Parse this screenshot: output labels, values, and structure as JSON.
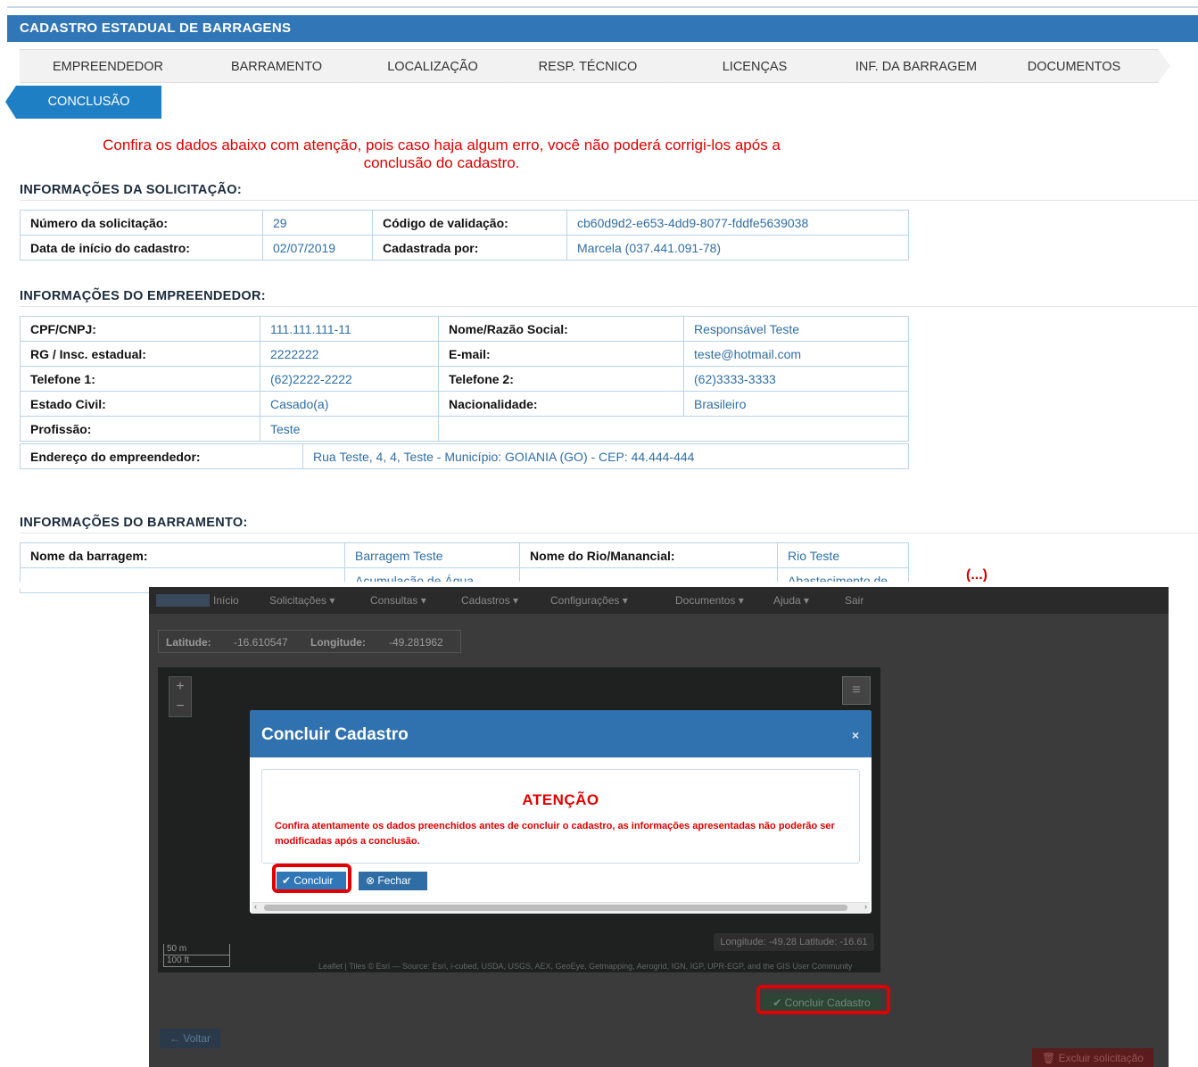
{
  "header": {
    "title": "CADASTRO ESTADUAL DE BARRAGENS"
  },
  "wizard": {
    "steps": [
      "EMPREENDEDOR",
      "BARRAMENTO",
      "LOCALIZAÇÃO",
      "RESP. TÉCNICO",
      "LICENÇAS",
      "INF. DA BARRAGEM",
      "DOCUMENTOS"
    ],
    "active_step": "CONCLUSÃO"
  },
  "warning_top": {
    "line1": "Confira os dados abaixo com atenção, pois caso haja algum erro, você não poderá corrigi-los após a",
    "line2": "conclusão do cadastro."
  },
  "solicitacao": {
    "title": "INFORMAÇÕES DA SOLICITAÇÃO:",
    "rows": [
      [
        "Número da solicitação:",
        "29",
        "Código de validação:",
        "cb60d9d2-e653-4dd9-8077-fddfe5639038"
      ],
      [
        "Data de início do cadastro:",
        "02/07/2019",
        "Cadastrada por:",
        "Marcela (037.441.091-78)"
      ]
    ]
  },
  "empreendedor": {
    "title": "INFORMAÇÕES DO EMPREENDEDOR:",
    "rows": [
      [
        "CPF/CNPJ:",
        "111.111.111-11",
        "Nome/Razão Social:",
        "Responsável Teste"
      ],
      [
        "RG / Insc. estadual:",
        "2222222",
        "E-mail:",
        "teste@hotmail.com"
      ],
      [
        "Telefone 1:",
        "(62)2222-2222",
        "Telefone 2:",
        "(62)3333-3333"
      ],
      [
        "Estado Civil:",
        "Casado(a)",
        "Nacionalidade:",
        "Brasileiro"
      ],
      [
        "Profissão:",
        "Teste",
        "",
        ""
      ]
    ],
    "endereco_label": "Endereço do empreendedor:",
    "endereco_value": "Rua Teste, 4, 4, Teste - Município: GOIANIA (GO) - CEP: 44.444-444"
  },
  "barramento": {
    "title": "INFORMAÇÕES DO BARRAMENTO:",
    "row1": [
      "Nome da barragem:",
      "Barragem Teste",
      "Nome do Rio/Manancial:",
      "Rio Teste"
    ],
    "row2_partial": [
      "Acumulação de Água -",
      "Abastecimento de"
    ]
  },
  "ellipsis": "(...)",
  "background_app": {
    "nav": [
      "Início",
      "Solicitações ▾",
      "Consultas ▾",
      "Cadastros ▾",
      "Configurações ▾",
      "Documentos ▾",
      "Ajuda ▾",
      "Sair"
    ],
    "latitude_label": "Latitude:",
    "latitude_value": "-16.610547",
    "longitude_label": "Longitude:",
    "longitude_value": "-49.281962",
    "scale_m": "50 m",
    "scale_ft": "100 ft",
    "coords_readout": "Longitude: -49.28 Latitude: -16.61",
    "attribution": "Leaflet | Tiles © Esri — Source: Esri, i-cubed, USDA, USGS, AEX, GeoEye, Getmapping, Aerogrid, IGN, IGP, UPR-EGP, and the GIS User Community",
    "concluir_cadastro_label": "Concluir Cadastro",
    "voltar_label": "Voltar",
    "excluir_label": "Excluir solicitação"
  },
  "modal": {
    "title": "Concluir Cadastro",
    "close": "×",
    "alert_title": "ATENÇÃO",
    "alert_text": "Confira atentamente os dados preenchidos antes de concluir o cadastro, as informações apresentadas não poderão ser modificadas após a conclusão.",
    "concluir_label": "Concluir",
    "fechar_label": "Fechar"
  },
  "colors": {
    "header": "#3177b8",
    "highlight": "#e00000",
    "warning_text": "#e00000"
  }
}
